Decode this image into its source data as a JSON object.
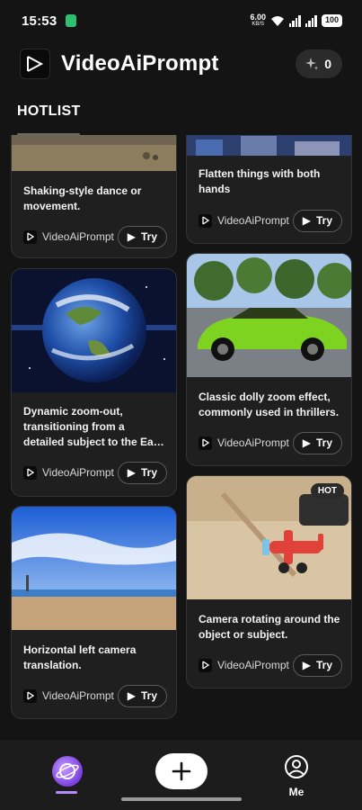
{
  "status_bar": {
    "time": "15:53",
    "net_speed": "6.00",
    "net_unit": "KB/S",
    "battery": "100"
  },
  "header": {
    "app_name": "VideoAiPrompt",
    "credits": "0",
    "logo_icon": "play-logo-icon",
    "credits_icon": "sparkle-icon"
  },
  "section": {
    "title": "HOTLIST"
  },
  "cards": [
    {
      "caption": "Shaking-style dance or movement.",
      "brand": "VideoAiPrompt",
      "try_label": "Try"
    },
    {
      "caption": "Flatten things with both hands",
      "brand": "VideoAiPrompt",
      "try_label": "Try"
    },
    {
      "caption": "Dynamic zoom-out, transitioning from a detailed subject to the Ea…",
      "brand": "VideoAiPrompt",
      "try_label": "Try"
    },
    {
      "caption": "Classic dolly zoom effect, commonly used in thrillers.",
      "brand": "VideoAiPrompt",
      "try_label": "Try"
    },
    {
      "caption": "Horizontal left camera translation.",
      "brand": "VideoAiPrompt",
      "try_label": "Try"
    },
    {
      "caption": "Camera rotating around the object or subject.",
      "brand": "VideoAiPrompt",
      "try_label": "Try",
      "badge": "HOT"
    }
  ],
  "bottom_nav": {
    "me_label": "Me",
    "home_icon": "planet-icon",
    "add_icon": "plus-icon",
    "me_icon": "user-icon"
  },
  "colors": {
    "background": "#141414",
    "card": "#1f1f1f",
    "accent": "#9b5cf6"
  }
}
